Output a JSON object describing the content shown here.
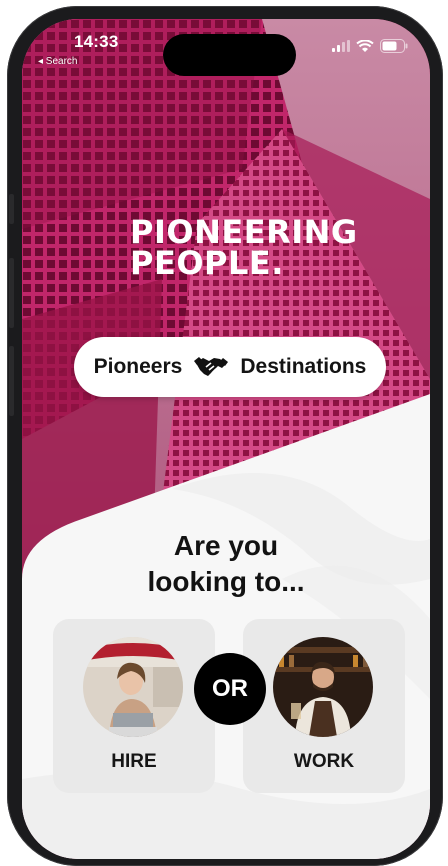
{
  "status_bar": {
    "time": "14:33",
    "back_label": "◂ Search"
  },
  "brand": {
    "line1": "PIONEERING",
    "line2": "PEOPLE."
  },
  "toggle": {
    "left_label": "Pioneers",
    "right_label": "Destinations",
    "icon": "handshake-icon"
  },
  "main": {
    "question_line1": "Are you",
    "question_line2": "looking to...",
    "separator": "OR",
    "options": [
      {
        "label": "HIRE"
      },
      {
        "label": "WORK"
      }
    ]
  },
  "colors": {
    "brand_magenta": "#b5195c",
    "sheet": "#f7f7f7",
    "card": "#e9e9e9"
  }
}
